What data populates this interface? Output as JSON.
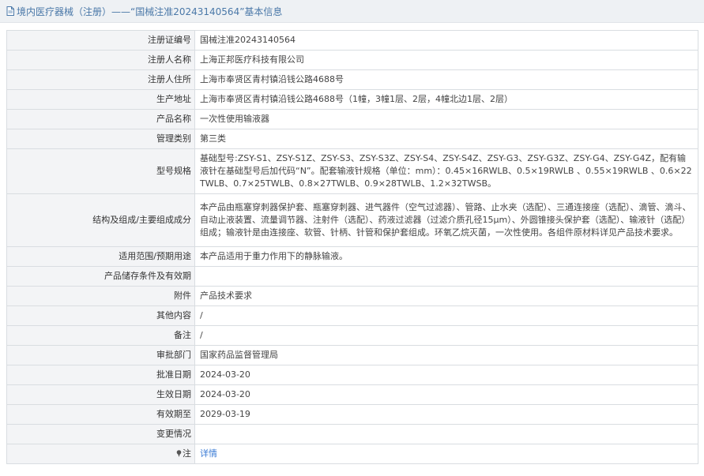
{
  "header": {
    "title": "境内医疗器械（注册）——“国械注准20243140564”基本信息"
  },
  "rows": [
    {
      "label": "注册证编号",
      "value": "国械注准20243140564"
    },
    {
      "label": "注册人名称",
      "value": "上海正邦医疗科技有限公司"
    },
    {
      "label": "注册人住所",
      "value": "上海市奉贤区青村镇沿钱公路4688号"
    },
    {
      "label": "生产地址",
      "value": "上海市奉贤区青村镇沿钱公路4688号（1幢，3幢1层、2层，4幢北边1层、2层）"
    },
    {
      "label": "产品名称",
      "value": "一次性使用输液器"
    },
    {
      "label": "管理类别",
      "value": "第三类"
    },
    {
      "label": "型号规格",
      "value": "基础型号:ZSY-S1、ZSY-S1Z、ZSY-S3、ZSY-S3Z、ZSY-S4、ZSY-S4Z、ZSY-G3、ZSY-G3Z、ZSY-G4、ZSY-G4Z，配有输液针在基础型号后加代码“N”。配套输液针规格（单位：mm）：0.45×16RWLB、0.5×19RWLB 、0.55×19RWLB 、0.6×22TWLB、0.7×25TWLB、0.8×27TWLB、0.9×28TWLB、1.2×32TWSB。"
    },
    {
      "label": "结构及组成/主要组成成分",
      "value": "本产品由瓶塞穿刺器保护套、瓶塞穿刺器、进气器件（空气过滤器）、管路、止水夹（选配）、三通连接座（选配）、滴管、滴斗、自动止液装置、流量调节器、注射件（选配）、药液过滤器（过滤介质孔径15μm）、外圆锥接头保护套（选配）、输液针（选配）组成；输液针是由连接座、软管、针柄、针管和保护套组成。环氧乙烷灭菌，一次性使用。各组件原材料详见产品技术要求。"
    },
    {
      "label": "适用范围/预期用途",
      "value": "本产品适用于重力作用下的静脉输液。"
    },
    {
      "label": "产品储存条件及有效期",
      "value": ""
    },
    {
      "label": "附件",
      "value": "产品技术要求"
    },
    {
      "label": "其他内容",
      "value": "/"
    },
    {
      "label": "备注",
      "value": "/"
    },
    {
      "label": "审批部门",
      "value": "国家药品监督管理局"
    },
    {
      "label": "批准日期",
      "value": "2024-03-20"
    },
    {
      "label": "生效日期",
      "value": "2024-03-20"
    },
    {
      "label": "有效期至",
      "value": "2029-03-19"
    },
    {
      "label": "变更情况",
      "value": ""
    }
  ],
  "note_row": {
    "label": "注",
    "link_text": "详情",
    "icon": "pin-icon"
  },
  "colors": {
    "link": "#3a7bd5",
    "title": "#4a78a8",
    "label_bg": "#f3f4f6",
    "border": "#d9dde1"
  }
}
